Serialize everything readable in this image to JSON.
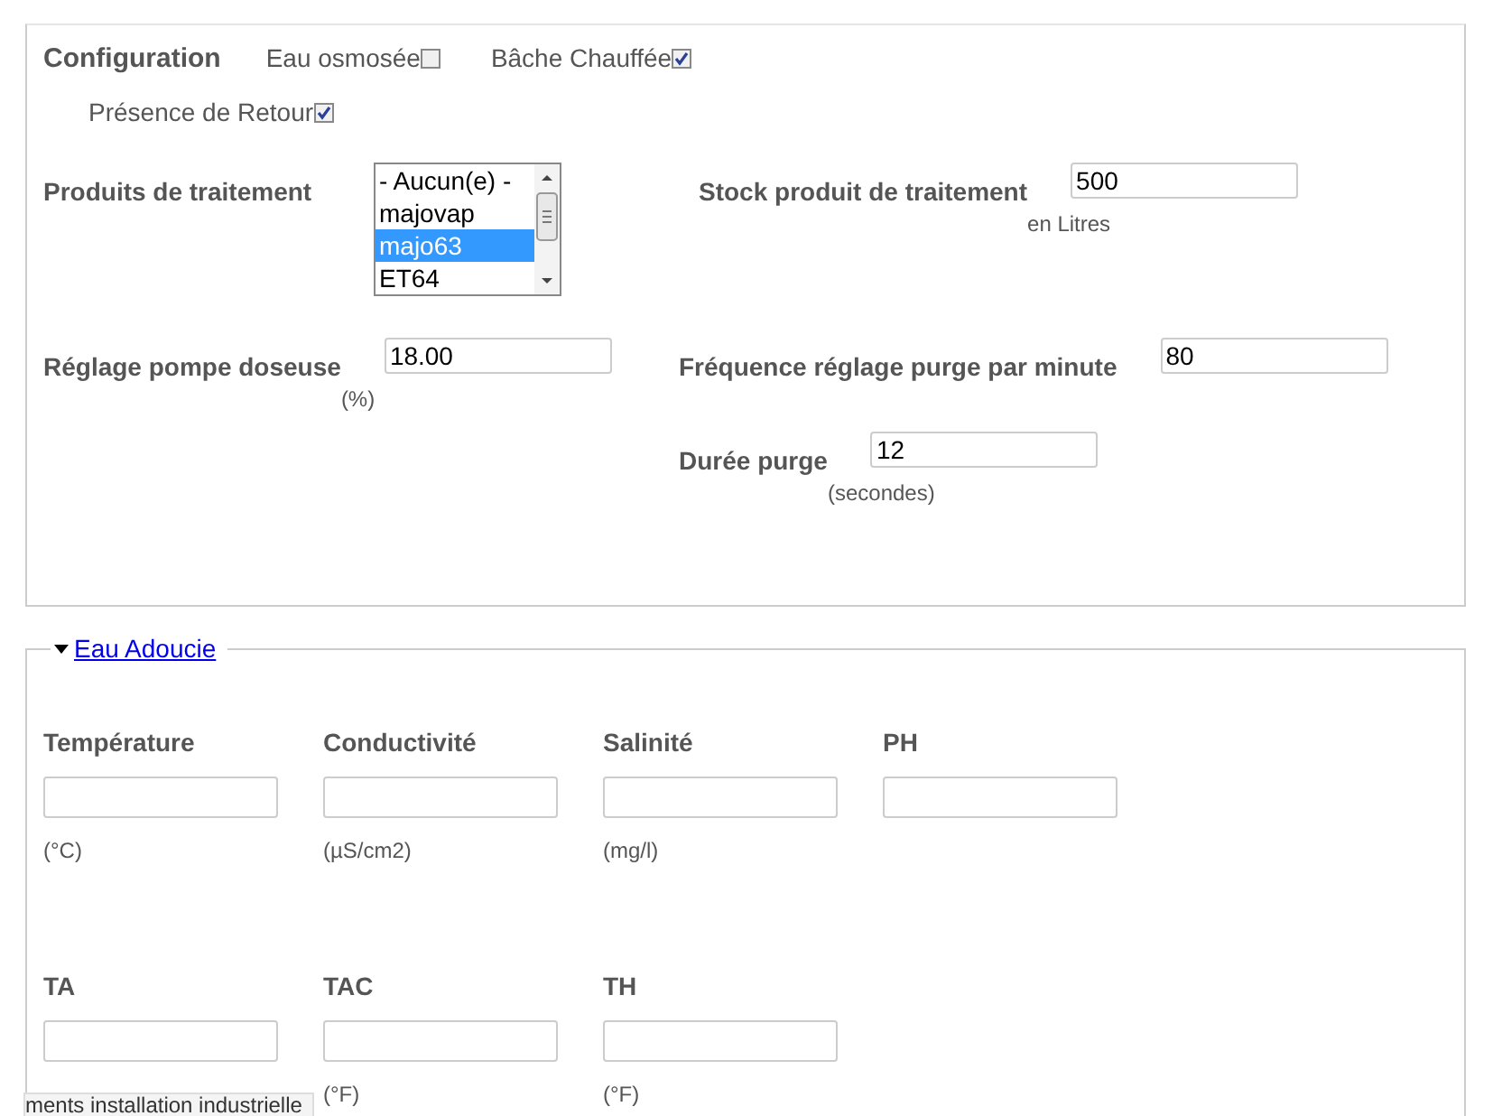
{
  "configuration": {
    "title": "Configuration",
    "options": [
      {
        "label": "Eau osmosée",
        "checked": false
      },
      {
        "label": "Bâche Chauffée",
        "checked": true
      },
      {
        "label": "Présence de Retour",
        "checked": true
      }
    ],
    "treatment_products": {
      "label": "Produits de traitement",
      "items": [
        {
          "label": "- Aucun(e) -",
          "selected": false
        },
        {
          "label": "majovap",
          "selected": false
        },
        {
          "label": "majo63",
          "selected": true
        },
        {
          "label": "ET64",
          "selected": false
        }
      ]
    },
    "fields": [
      {
        "label": "Stock produit de traitement",
        "value": "500",
        "unit": "en Litres"
      },
      {
        "label": "Réglage pompe doseuse",
        "value": "18.00",
        "unit": "(%)"
      },
      {
        "label": "Fréquence réglage purge par minute",
        "value": "80"
      },
      {
        "label": "Durée purge",
        "value": "12",
        "unit": "(secondes)"
      }
    ]
  },
  "eau_adoucie": {
    "title": "Eau Adoucie",
    "expanded": true,
    "measures": [
      {
        "label": "Température",
        "unit": "(°C)"
      },
      {
        "label": "Conductivité",
        "unit": "(µS/cm2)"
      },
      {
        "label": "Salinité",
        "unit": "(mg/l)"
      },
      {
        "label": "PH"
      },
      {
        "label": "TA"
      },
      {
        "label": "TAC",
        "unit": "(°F)"
      },
      {
        "label": "TH",
        "unit": "(°F)"
      }
    ]
  },
  "tooltip": "ments installation industrielle"
}
